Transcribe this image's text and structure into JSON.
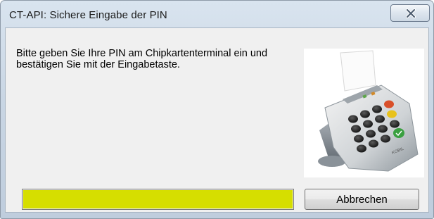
{
  "window": {
    "title": "CT-API: Sichere Eingabe der PIN"
  },
  "message": {
    "line1": "Bitte geben Sie Ihre PIN am Chipkartenterminal ein und",
    "line2": "bestätigen Sie mit der Eingabetaste."
  },
  "progress": {
    "value_percent": 100,
    "color": "#d6de00"
  },
  "buttons": {
    "cancel_label": "Abbrechen"
  },
  "icons": {
    "close": "close-icon",
    "device": "card-terminal-image"
  },
  "device_logo": "KOBIL"
}
